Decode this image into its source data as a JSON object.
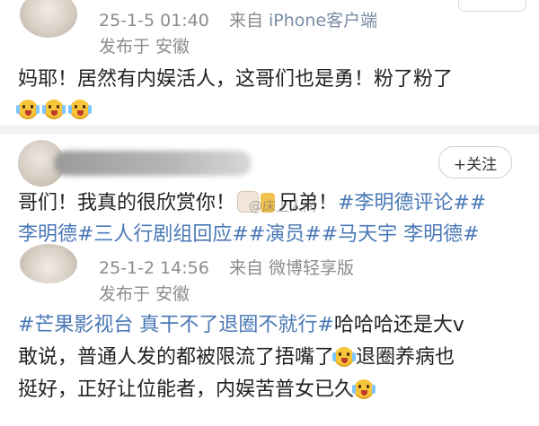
{
  "posts": [
    {
      "time": "25-1-5 01:40",
      "source_prefix": "来自",
      "source": "iPhone客户端",
      "location": "发布于 安徽",
      "text": "妈耶！居然有内娱活人，这哥们也是勇！粉了粉了",
      "emoji_names": [
        "scream-emoji",
        "scream-emoji",
        "scream-emoji"
      ]
    },
    {
      "follow_label": "+关注",
      "watermark": "@床上人间",
      "line1_plain1": "哥们！我真的很欣赏你！",
      "line1_plain2": "兄弟！",
      "line1_link": "#李明德评论##",
      "line2_link": "李明德#三人行剧组回应##演员##马天宇 李明德#"
    },
    {
      "time": "25-1-2 14:56",
      "source_prefix": "来自",
      "source": "微博轻享版",
      "location": "发布于 安徽",
      "line1_link": "#芒果影视台 真干不了退圈不就行#",
      "line1_plain": "哈哈哈还是大v",
      "line2": "敢说，普通人发的都被限流了捂嘴了",
      "line2_after": "退圈养病也",
      "line3": "挺好，正好让位能者，内娱苦普女已久"
    }
  ],
  "colors": {
    "link": "#4a78b6",
    "meta": "#8c8c8c",
    "source": "#7a8ca6",
    "divider": "#f2f2f2"
  }
}
